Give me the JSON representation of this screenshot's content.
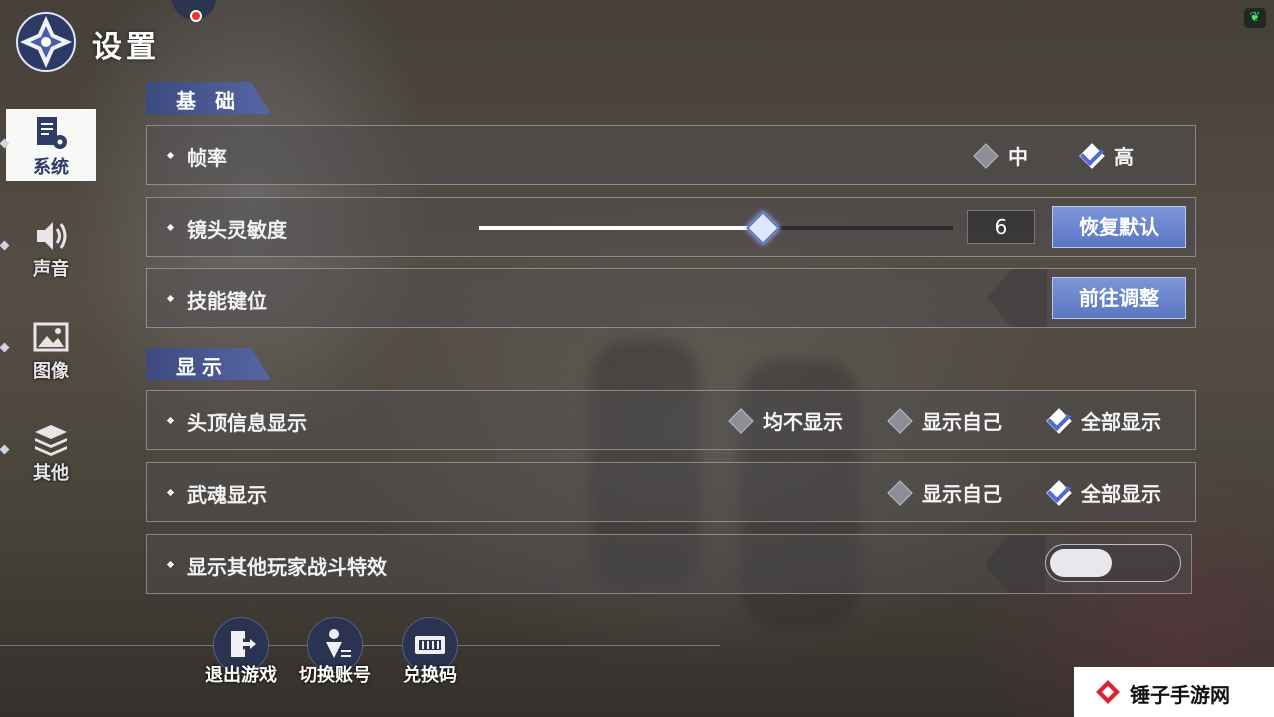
{
  "header": {
    "title": "设置"
  },
  "sidebar": {
    "items": [
      {
        "label": "系统",
        "icon": "document-gear-icon",
        "active": true
      },
      {
        "label": "声音",
        "icon": "speaker-icon",
        "active": false
      },
      {
        "label": "图像",
        "icon": "image-icon",
        "active": false
      },
      {
        "label": "其他",
        "icon": "layers-icon",
        "active": false
      }
    ]
  },
  "sections": {
    "basic": "基 础",
    "display": "显示"
  },
  "rows": {
    "frame_rate": {
      "label": "帧率",
      "options": [
        {
          "label": "中",
          "selected": false
        },
        {
          "label": "高",
          "selected": true
        }
      ]
    },
    "camera_sensitivity": {
      "label": "镜头灵敏度",
      "value": "6",
      "max": 10,
      "reset_label": "恢复默认"
    },
    "skill_keys": {
      "label": "技能键位",
      "button": "前往调整"
    },
    "head_info": {
      "label": "头顶信息显示",
      "options": [
        {
          "label": "均不显示",
          "selected": false
        },
        {
          "label": "显示自己",
          "selected": false
        },
        {
          "label": "全部显示",
          "selected": true
        }
      ]
    },
    "spirit_display": {
      "label": "武魂显示",
      "options": [
        {
          "label": "显示自己",
          "selected": false
        },
        {
          "label": "全部显示",
          "selected": true
        }
      ]
    },
    "battle_effects": {
      "label": "显示其他玩家战斗特效",
      "enabled": false
    }
  },
  "actions": [
    {
      "label": "退出游戏",
      "icon": "exit-icon"
    },
    {
      "label": "切换账号",
      "icon": "switch-account-icon"
    },
    {
      "label": "兑换码",
      "icon": "ticket-icon"
    }
  ],
  "watermark": {
    "text": "锤子手游网"
  },
  "colors": {
    "accent": "#5a76c2",
    "check": "#4e6cd6"
  }
}
